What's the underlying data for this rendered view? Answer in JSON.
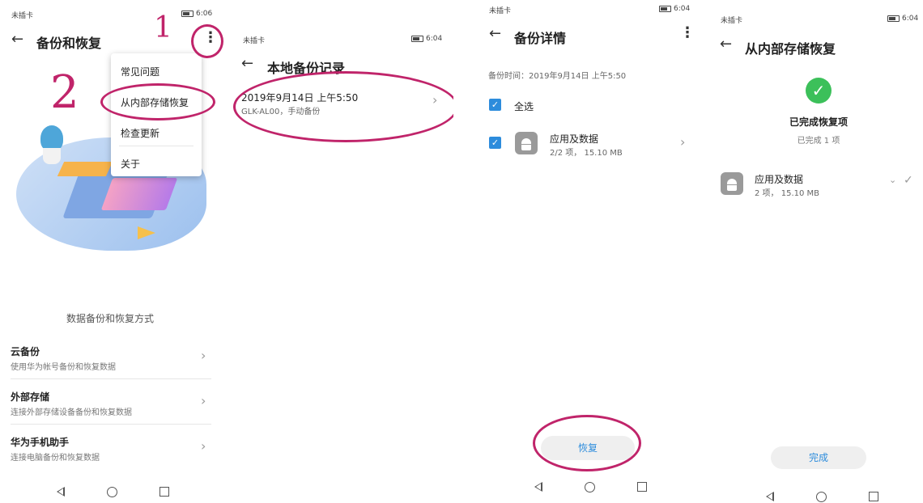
{
  "panel1": {
    "status_left": "未插卡",
    "status_time": "6:06",
    "title": "备份和恢复",
    "menu": [
      "常见问题",
      "从内部存储恢复",
      "检查更新",
      "关于"
    ],
    "annot_1": "1",
    "annot_2": "2",
    "section_heading": "数据备份和恢复方式",
    "items": [
      {
        "title": "云备份",
        "subtitle": "使用华为帐号备份和恢复数据"
      },
      {
        "title": "外部存储",
        "subtitle": "连接外部存储设备备份和恢复数据"
      },
      {
        "title": "华为手机助手",
        "subtitle": "连接电脑备份和恢复数据"
      }
    ]
  },
  "panel2": {
    "status_left": "未插卡",
    "status_time": "6:04",
    "title": "本地备份记录",
    "record_date": "2019年9月14日 上午5:50",
    "record_desc": "GLK-AL00，手动备份"
  },
  "panel3": {
    "status_left": "未插卡",
    "status_time": "6:04",
    "title": "备份详情",
    "backup_time": "备份时间：2019年9月14日 上午5:50",
    "select_all": "全选",
    "item_title": "应用及数据",
    "item_sub": "2/2 项，  15.10 MB",
    "restore_button": "恢复"
  },
  "panel4": {
    "status_left": "未插卡",
    "status_time": "6:04",
    "title": "从内部存储恢复",
    "done_heading": "已完成恢复项",
    "done_count": "已完成 1 项",
    "item_title": "应用及数据",
    "item_sub": "2 项，  15.10 MB",
    "finish_button": "完成"
  },
  "colors": {
    "accent": "#2d8cdc",
    "annotation": "#c0246a",
    "check_green": "#3cc05a"
  },
  "icons": [
    "back-arrow-icon",
    "more-vert-icon",
    "chevron-right-icon",
    "checkbox-icon",
    "android-icon",
    "success-check-icon",
    "nav-back-icon",
    "nav-home-icon",
    "nav-recent-icon"
  ]
}
